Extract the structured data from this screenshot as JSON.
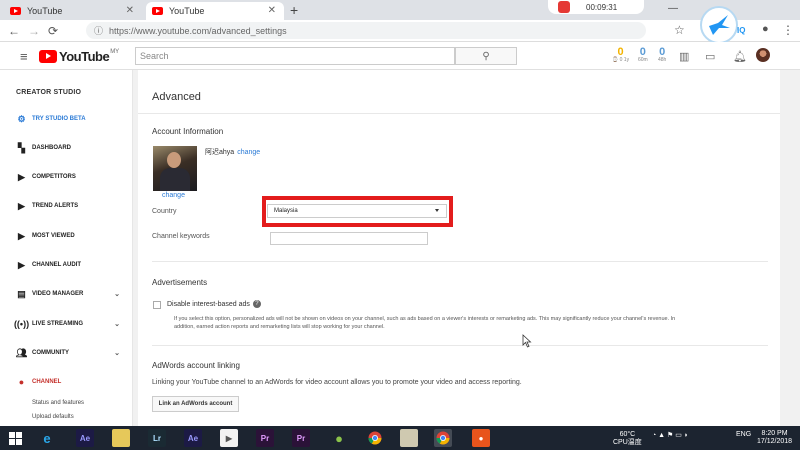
{
  "browser": {
    "tabs": [
      {
        "title": "YouTube",
        "active": false
      },
      {
        "title": "YouTube",
        "active": true
      }
    ],
    "new_tab_symbol": "+",
    "recorder_time": "00:09:31",
    "url": "https://www.youtube.com/advanced_settings",
    "bird_label": "IQ"
  },
  "header": {
    "logo_text": "YouTube",
    "logo_country": "MY",
    "search_placeholder": "Search",
    "stats": [
      {
        "value": "0",
        "label": "⌚ 0 1y"
      },
      {
        "value": "0",
        "label": "60m"
      },
      {
        "value": "0",
        "label": "48h"
      }
    ]
  },
  "sidebar": {
    "title": "CREATOR STUDIO",
    "items": [
      {
        "label": "TRY STUDIO BETA",
        "icon": "gear-icon"
      },
      {
        "label": "DASHBOARD",
        "icon": "dashboard-icon"
      },
      {
        "label": "COMPETITORS",
        "icon": "vidiq-icon"
      },
      {
        "label": "TREND ALERTS",
        "icon": "vidiq-icon"
      },
      {
        "label": "MOST VIEWED",
        "icon": "vidiq-icon"
      },
      {
        "label": "CHANNEL AUDIT",
        "icon": "vidiq-icon"
      },
      {
        "label": "VIDEO MANAGER",
        "icon": "video-manager-icon"
      },
      {
        "label": "LIVE STREAMING",
        "icon": "live-icon"
      },
      {
        "label": "COMMUNITY",
        "icon": "community-icon"
      },
      {
        "label": "CHANNEL",
        "icon": "channel-icon"
      }
    ],
    "sub_items": [
      "Status and features",
      "Upload defaults"
    ]
  },
  "main": {
    "title": "Advanced",
    "account_info": {
      "heading": "Account Information",
      "channel_name": "阿迟ahya",
      "change_link": "change",
      "image_change_link": "change",
      "country_label": "Country",
      "country_value": "Malaysia",
      "keywords_label": "Channel keywords"
    },
    "advertisements": {
      "heading": "Advertisements",
      "checkbox_label": "Disable interest-based ads",
      "help_symbol": "?",
      "description": "If you select this option, personalized ads will not be shown on videos on your channel, such as ads based on a viewer's interests or remarketing ads. This may significantly reduce your channel's revenue. In addition, earned action reports and remarketing lists will stop working for your channel."
    },
    "adwords": {
      "heading": "AdWords account linking",
      "text": "Linking your YouTube channel to an AdWords for video account allows you to promote your video and access reporting.",
      "button_label": "Link an AdWords account"
    }
  },
  "taskbar": {
    "apps": [
      "Ae",
      "Lr",
      "Ae",
      "Pr",
      "Pr"
    ],
    "temp": "60°C",
    "temp_label": "CPU温度",
    "lang": "ENG",
    "time": "8:20 PM",
    "date": "17/12/2018"
  }
}
